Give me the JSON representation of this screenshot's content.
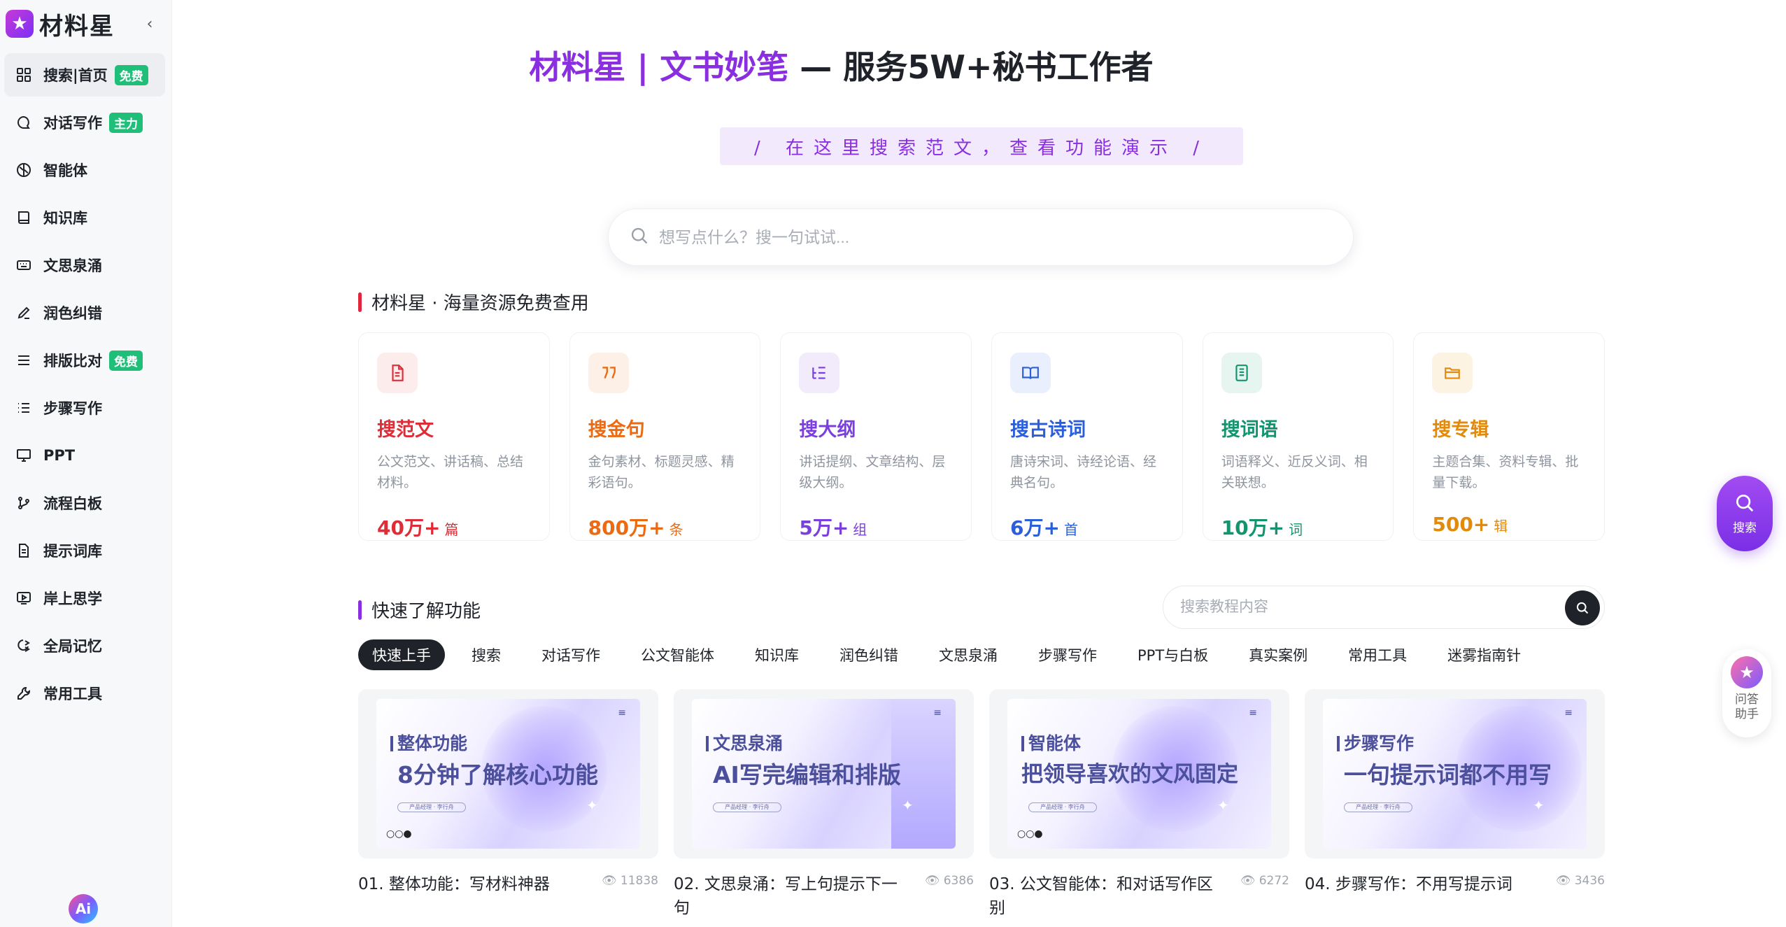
{
  "app": {
    "logo_text": "材料星",
    "collapse_icon": "chevron-left-icon"
  },
  "sidebar": {
    "items": [
      {
        "label": "搜索|首页",
        "icon": "grid-icon",
        "badge": "免费",
        "active": true
      },
      {
        "label": "对话写作",
        "icon": "chat-bubble-icon",
        "badge": "主力"
      },
      {
        "label": "智能体",
        "icon": "brain-icon"
      },
      {
        "label": "知识库",
        "icon": "book-icon"
      },
      {
        "label": "文思泉涌",
        "icon": "keyboard-icon"
      },
      {
        "label": "润色纠错",
        "icon": "pen-icon"
      },
      {
        "label": "排版比对",
        "icon": "menu-lines-icon",
        "badge": "免费"
      },
      {
        "label": "步骤写作",
        "icon": "list-icon"
      },
      {
        "label": "PPT",
        "icon": "monitor-icon"
      },
      {
        "label": "流程白板",
        "icon": "flow-icon"
      },
      {
        "label": "提示词库",
        "icon": "document-icon"
      },
      {
        "label": "岸上思学",
        "icon": "video-play-icon"
      },
      {
        "label": "全局记忆",
        "icon": "memory-icon"
      },
      {
        "label": "常用工具",
        "icon": "wrench-icon"
      }
    ],
    "footer_badge": "Ai"
  },
  "hero": {
    "brand": "材料星 | 文书妙笔",
    "rest": " — 服务5W+秘书工作者",
    "slogan": "/ 在这里搜索范文，查看功能演示 /"
  },
  "search": {
    "placeholder": "想写点什么？搜一句试试..."
  },
  "resources": {
    "title": "材料星 · 海量资源免费查用",
    "accent": "#e0263c",
    "cards": [
      {
        "title": "搜范文",
        "desc": "公文范文、讲话稿、总结材料。",
        "count": "40万+",
        "unit": "篇",
        "color": "#e02c36",
        "bg": "#fdecec",
        "icon": "document-icon"
      },
      {
        "title": "搜金句",
        "desc": "金句素材、标题灵感、精彩语句。",
        "count": "800万+",
        "unit": "条",
        "color": "#ec6a12",
        "bg": "#fdf0e6",
        "icon": "quote-icon"
      },
      {
        "title": "搜大纲",
        "desc": "讲话提纲、文章结构、层级大纲。",
        "count": "5万+",
        "unit": "组",
        "color": "#7b3fe0",
        "bg": "#f1ebfc",
        "icon": "outline-icon"
      },
      {
        "title": "搜古诗词",
        "desc": "唐诗宋词、诗经论语、经典名句。",
        "count": "6万+",
        "unit": "首",
        "color": "#2b5fd9",
        "bg": "#e9effc",
        "icon": "open-book-icon"
      },
      {
        "title": "搜词语",
        "desc": "词语释义、近反义词、相关联想。",
        "count": "10万+",
        "unit": "词",
        "color": "#13946e",
        "bg": "#e6f5ef",
        "icon": "notebook-icon"
      },
      {
        "title": "搜专辑",
        "desc": "主题合集、资料专辑、批量下载。",
        "count": "500+",
        "unit": "辑",
        "color": "#e28a0c",
        "bg": "#fdf3e2",
        "icon": "folder-icon"
      }
    ]
  },
  "tutorials": {
    "title": "快速了解功能",
    "accent": "#8a2fe0",
    "search_placeholder": "搜索教程内容",
    "tabs": [
      "快速上手",
      "搜索",
      "对话写作",
      "公文智能体",
      "知识库",
      "润色纠错",
      "文思泉涌",
      "步骤写作",
      "PPT与白板",
      "真实案例",
      "常用工具",
      "迷雾指南针"
    ],
    "videos": [
      {
        "tag": "整体功能",
        "headline": "8分钟了解核心功能",
        "pill": "产品经理 · 李行舟",
        "title": "01. 整体功能：写材料神器",
        "views": "11838"
      },
      {
        "tag": "文思泉涌",
        "headline": "AI写完编辑和排版",
        "pill": "产品经理 · 李行舟",
        "title": "02. 文思泉涌：写上句提示下一句",
        "views": "6386"
      },
      {
        "tag": "智能体",
        "headline": "把领导喜欢的文风固定",
        "pill": "产品经理 · 李行舟",
        "title": "03. 公文智能体：和对话写作区别",
        "views": "6272"
      },
      {
        "tag": "步骤写作",
        "headline": "一句提示词都不用写",
        "pill": "产品经理 · 李行舟",
        "title": "04. 步骤写作：不用写提示词",
        "views": "3436"
      }
    ]
  },
  "floating": {
    "search_label": "搜索",
    "assistant_label": "问答助手"
  }
}
